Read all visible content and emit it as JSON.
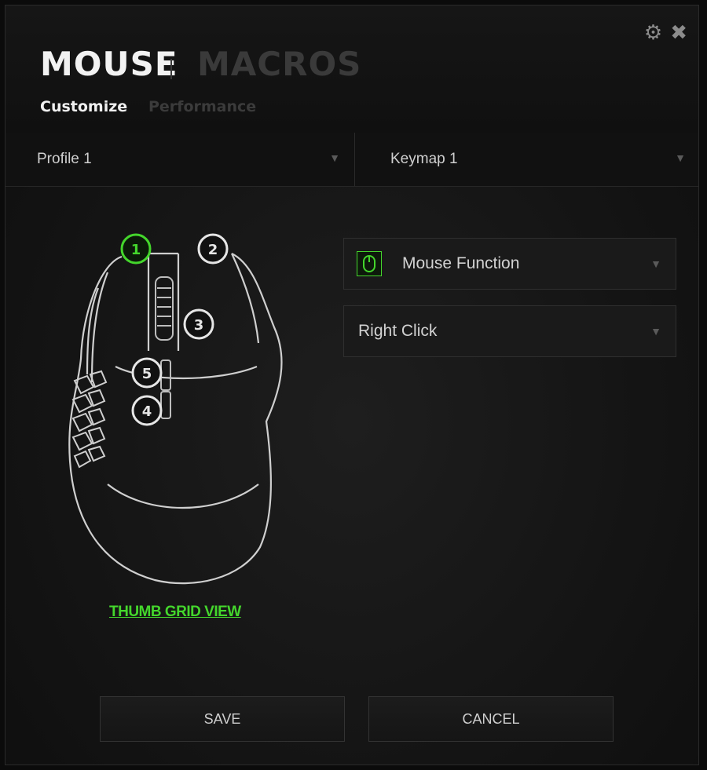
{
  "header": {
    "tabs": [
      {
        "label": "MOUSE",
        "active": true
      },
      {
        "label": "MACROS",
        "active": false
      }
    ],
    "subtabs": [
      {
        "label": "Customize",
        "active": true
      },
      {
        "label": "Performance",
        "active": false
      }
    ],
    "window_icons": [
      "gear-icon",
      "close-icon"
    ]
  },
  "selectors": {
    "profile": "Profile 1",
    "keymap": "Keymap 1"
  },
  "mouse_diagram": {
    "buttons": [
      "1",
      "2",
      "3",
      "4",
      "5"
    ],
    "selected_button": "1"
  },
  "link": {
    "thumb_grid": "THUMB GRID VIEW"
  },
  "assignment": {
    "function": "Mouse Function",
    "action": "Right Click"
  },
  "footer": {
    "save": "SAVE",
    "cancel": "CANCEL"
  },
  "colors": {
    "accent": "#44d62c",
    "background": "#141414",
    "text": "#d8d8d8"
  }
}
